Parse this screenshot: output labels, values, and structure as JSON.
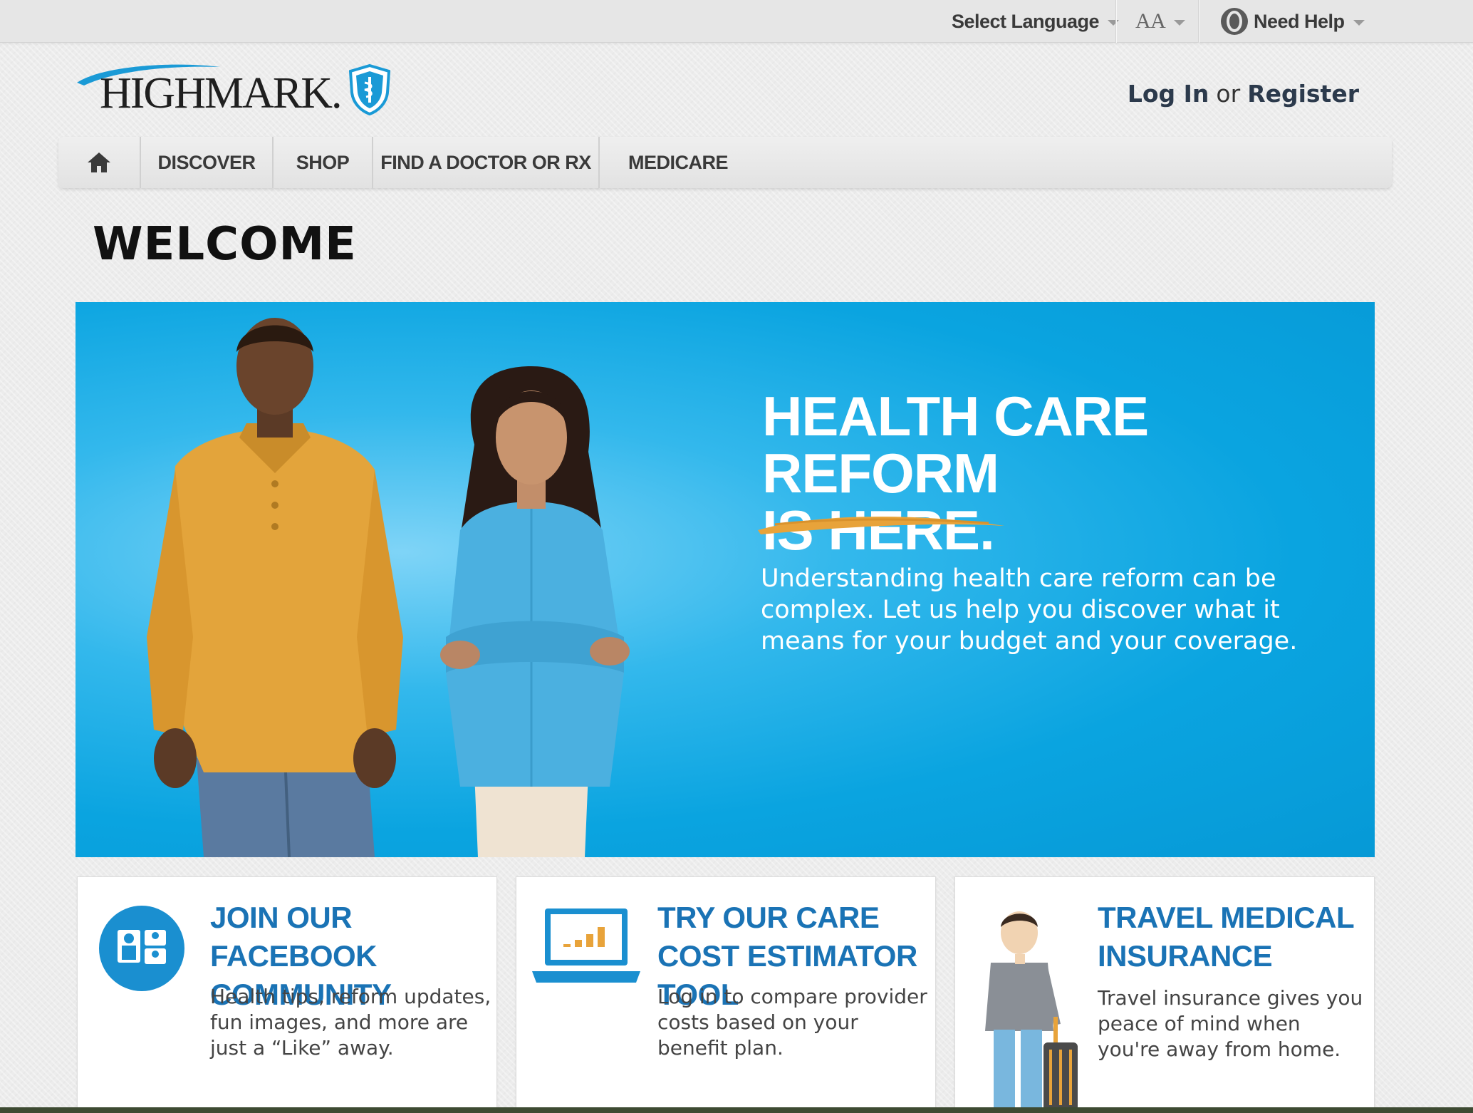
{
  "utility": {
    "language_label": "Select Language",
    "text_size_label": "AA",
    "help_label": "Need Help"
  },
  "header": {
    "logo_text": "HIGHMARK.",
    "login_label": "Log In",
    "or_label": "or",
    "register_label": "Register"
  },
  "nav": {
    "items": [
      {
        "label": "DISCOVER"
      },
      {
        "label": "SHOP"
      },
      {
        "label": "FIND A DOCTOR OR RX"
      },
      {
        "label": "MEDICARE"
      }
    ]
  },
  "page": {
    "title": "WELCOME"
  },
  "hero": {
    "title_line1": "HEALTH CARE REFORM",
    "title_line2": "IS HERE.",
    "body": "Understanding health care reform can be complex. Let us help you discover what it means for your budget and your coverage."
  },
  "cards": [
    {
      "title": "JOIN OUR FACEBOOK COMMUNITY",
      "text": "Health tips, reform updates, fun images, and more are just a “Like” away.",
      "icon": "community-icon"
    },
    {
      "title": "TRY OUR CARE COST ESTIMATOR TOOL",
      "text": "Log in to compare provider costs based on your benefit plan.",
      "icon": "laptop-chart-icon"
    },
    {
      "title": "TRAVEL MEDICAL INSURANCE",
      "text": "Travel insurance gives you peace of mind when you're away from home.",
      "icon": "traveler-icon"
    }
  ],
  "colors": {
    "hero_blue": "#0aa4e0",
    "card_title_blue": "#1a73b5",
    "accent_orange": "#e8a33a",
    "shield_blue": "#1a9ad6"
  }
}
